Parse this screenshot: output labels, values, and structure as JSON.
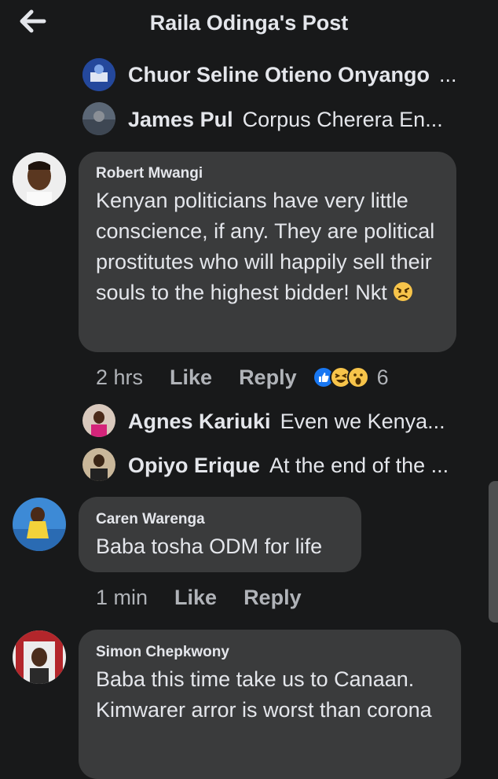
{
  "header": {
    "title": "Raila Odinga's Post"
  },
  "replies_top": [
    {
      "name": "Chuor Seline Otieno Onyango",
      "text": "..."
    },
    {
      "name": "James Pul",
      "text": "Corpus Cherera En..."
    }
  ],
  "comments": [
    {
      "author": "Robert Mwangi",
      "text": "Kenyan politicians have very little conscience, if any. They are political  prostitutes who will happily sell their souls to the highest bidder! Nkt",
      "time": "2 hrs",
      "like": "Like",
      "reply": "Reply",
      "reactions_count": "6"
    },
    {
      "author": "Caren Warenga",
      "text": "Baba tosha ODM for life",
      "time": "1 min",
      "like": "Like",
      "reply": "Reply"
    },
    {
      "author": "Simon Chepkwony",
      "text": "Baba this time take us to Canaan. Kimwarer arror is worst than corona"
    }
  ],
  "replies_mid": [
    {
      "name": "Agnes Kariuki",
      "text": "Even we Kenya..."
    },
    {
      "name": "Opiyo Erique",
      "text": "At the end of the ..."
    }
  ],
  "colors": {
    "bg": "#18191a",
    "bubble": "#3a3b3c",
    "text": "#e4e6eb",
    "meta": "#b0b3b8",
    "like_blue": "#1877f2"
  },
  "icons": [
    "back-arrow-icon",
    "like-reaction-icon",
    "haha-reaction-icon",
    "wow-reaction-icon",
    "angry-emoji-icon"
  ]
}
